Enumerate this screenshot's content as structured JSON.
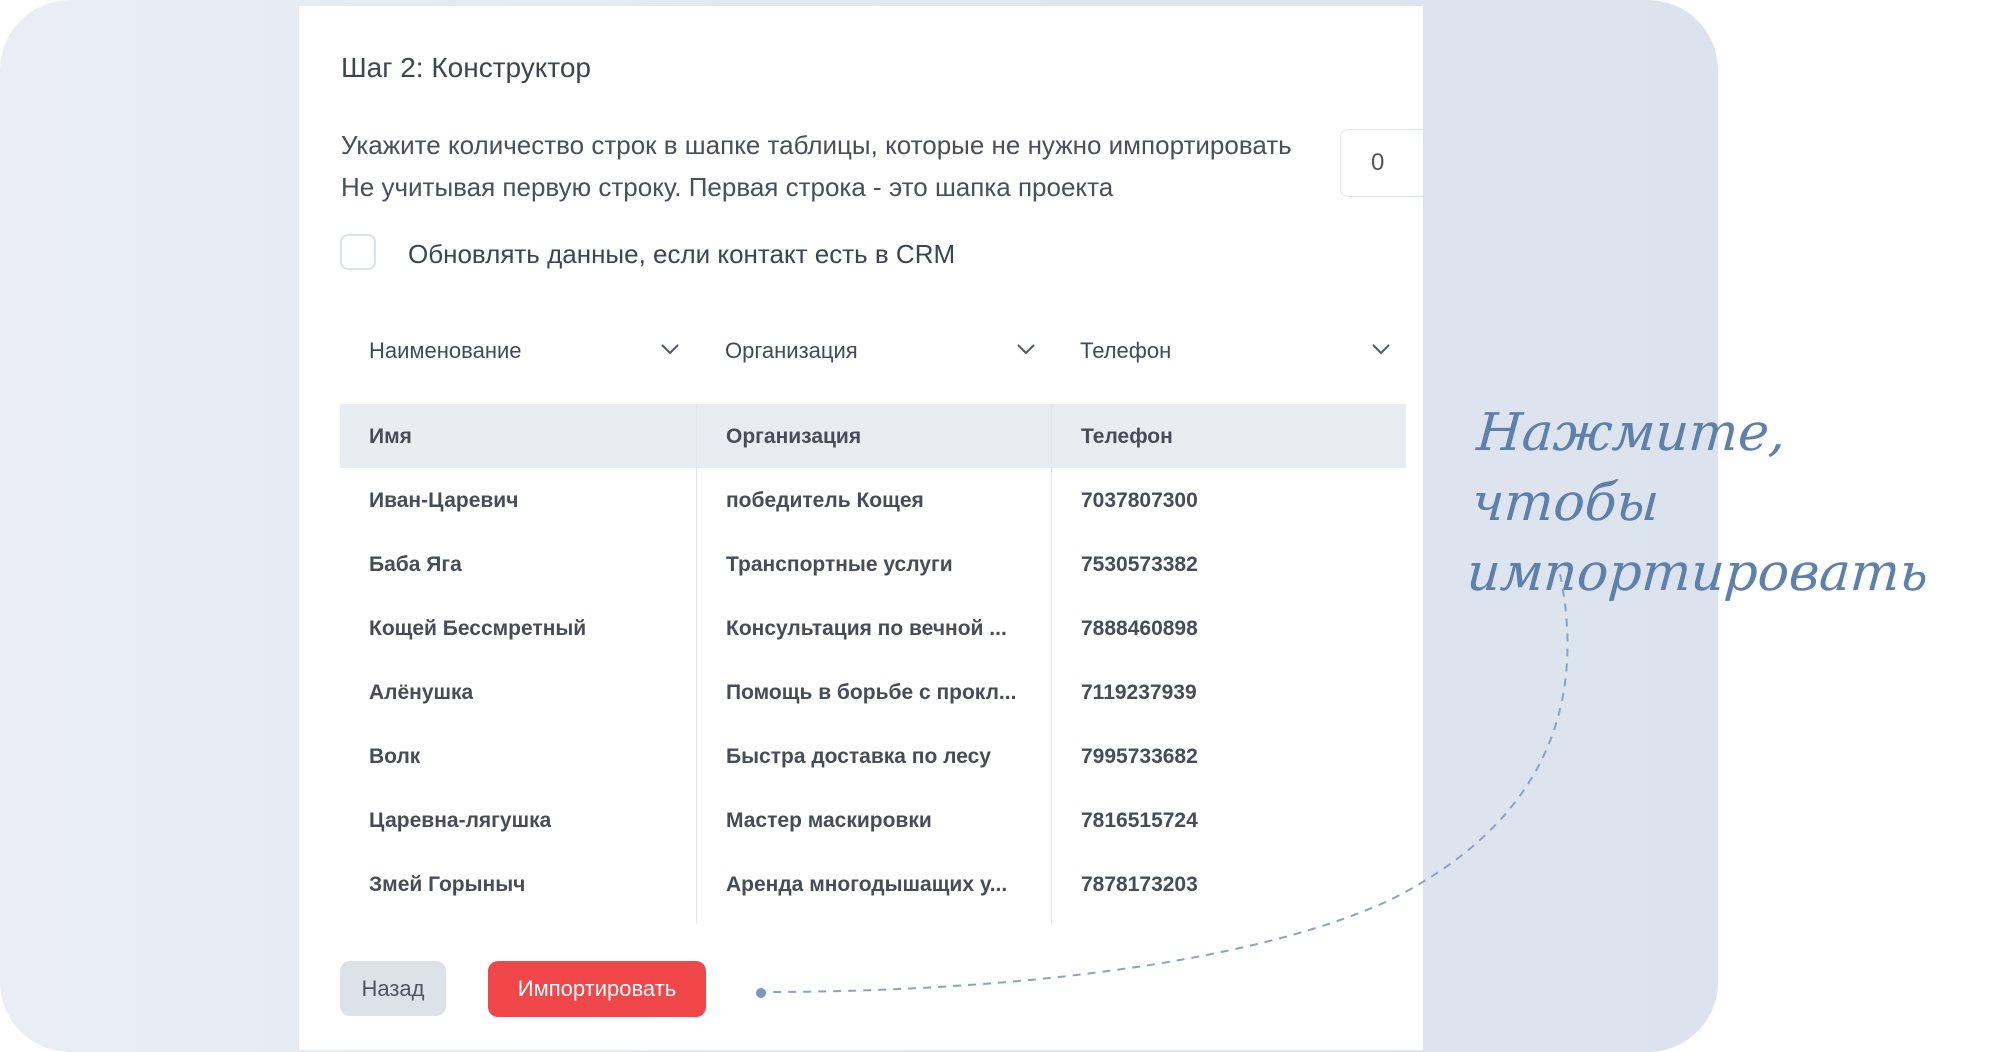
{
  "step_title": "Шаг 2: Конструктор",
  "description": {
    "line1": "Укажите количество строк в шапке таблицы, которые не нужно импортировать",
    "line2": "Не учитывая первую строку. Первая строка - это шапка проекта"
  },
  "rows_skip_value": "0",
  "update_checkbox": {
    "label": "Обновлять данные, если контакт есть в CRM",
    "checked": false
  },
  "column_selects": [
    "Наименование",
    "Организация",
    "Телефон"
  ],
  "table": {
    "headers": [
      "Имя",
      "Организация",
      "Телефон"
    ],
    "rows": [
      [
        "Иван-Царевич",
        "победитель Кощея",
        "7037807300"
      ],
      [
        "Баба Яга",
        "Транспортные услуги",
        "7530573382"
      ],
      [
        "Кощей Бессмретный",
        "Консультация по вечной ...",
        "7888460898"
      ],
      [
        "Алёнушка",
        "Помощь в борьбе с прокл...",
        "7119237939"
      ],
      [
        "Волк",
        "Быстра доставка по лесу",
        "7995733682"
      ],
      [
        "Царевна-лягушка",
        "Мастер маскировки",
        "7816515724"
      ],
      [
        "Змей Горыныч",
        "Аренда многодышащих у...",
        "7878173203"
      ]
    ]
  },
  "buttons": {
    "back": "Назад",
    "import": "Импортировать"
  },
  "hint": {
    "line1": "Нажмите, чтобы",
    "line2": "импортировать"
  },
  "colors": {
    "import_button": "#f0474a",
    "hint_text": "#5d80ad",
    "table_header_bg": "#e9edf2"
  }
}
